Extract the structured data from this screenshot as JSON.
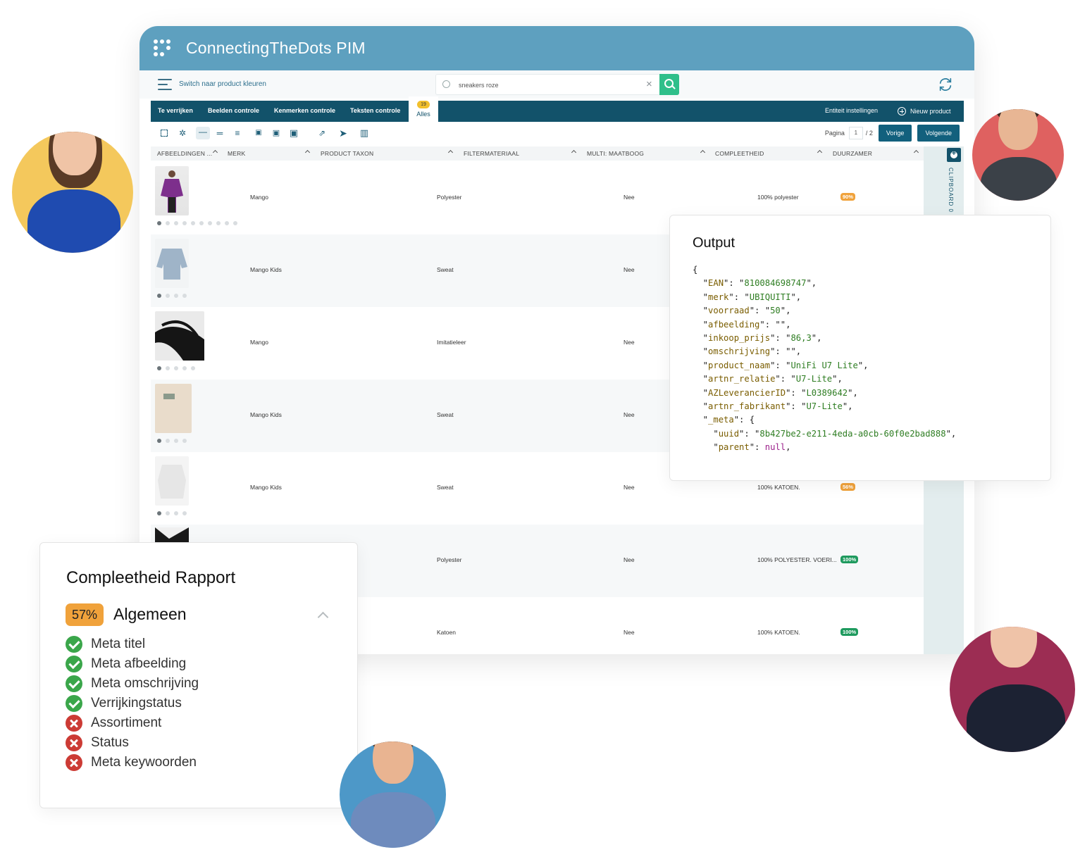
{
  "app": {
    "title": "ConnectingTheDots PIM"
  },
  "toolbar": {
    "switch_label": "Switch naar product kleuren",
    "search_value": "sneakers roze"
  },
  "tabs": [
    {
      "label": "Te verrijken"
    },
    {
      "label": "Beelden controle"
    },
    {
      "label": "Kenmerken controle"
    },
    {
      "label": "Teksten controle"
    },
    {
      "label": "Alles",
      "badge": "19",
      "active": true
    }
  ],
  "tab_actions": {
    "entity_settings": "Entiteit instellingen",
    "new_product": "Nieuw product"
  },
  "pager": {
    "label": "Pagina",
    "current": "1",
    "total": "/ 2",
    "prev": "Vorige",
    "next": "Volgende"
  },
  "columns": [
    "AFBEELDINGEN ...",
    "MERK",
    "PRODUCT TAXON",
    "FILTERMATERIAAL",
    "MULTI: MAATBOOG",
    "COMPLEETHEID",
    "DUURZAMER"
  ],
  "rows": [
    {
      "merk": "Mango",
      "taxon": "Polyester",
      "maatboog": "Nee",
      "material": "100% polyester",
      "pct": "90%",
      "pct_color": "#f0a23b",
      "image_count": 11
    },
    {
      "merk": "Mango Kids",
      "taxon": "Sweat",
      "maatboog": "Nee",
      "material": "",
      "pct": "",
      "pct_color": "",
      "image_count": 4
    },
    {
      "merk": "Mango",
      "taxon": "Imitatieleer",
      "maatboog": "Nee",
      "material": "",
      "pct": "",
      "pct_color": "",
      "image_count": 5
    },
    {
      "merk": "Mango Kids",
      "taxon": "Sweat",
      "maatboog": "Nee",
      "material": "",
      "pct": "",
      "pct_color": "",
      "image_count": 4
    },
    {
      "merk": "Mango Kids",
      "taxon": "Sweat",
      "maatboog": "Nee",
      "material": "100% KATOEN.",
      "pct": "56%",
      "pct_color": "#f0a23b",
      "image_count": 4
    },
    {
      "merk": "",
      "taxon": "Polyester",
      "maatboog": "Nee",
      "material": "100% POLYESTER. VOERI...",
      "pct": "100%",
      "pct_color": "#1e9a5e",
      "image_count": 0
    },
    {
      "merk": "",
      "taxon": "Katoen",
      "maatboog": "Nee",
      "material": "100% KATOEN.",
      "pct": "100%",
      "pct_color": "#1e9a5e",
      "image_count": 0
    }
  ],
  "clipboard": {
    "label": "CLIPBOARD",
    "count": "0"
  },
  "output": {
    "title": "Output",
    "fields": [
      {
        "key": "EAN",
        "value": "810084698747"
      },
      {
        "key": "merk",
        "value": "UBIQUITI"
      },
      {
        "key": "voorraad",
        "value": "50"
      },
      {
        "key": "afbeelding",
        "value": ""
      },
      {
        "key": "inkoop_prijs",
        "value": "86,3"
      },
      {
        "key": "omschrijving",
        "value": ""
      },
      {
        "key": "product_naam",
        "value": "UniFi U7 Lite"
      },
      {
        "key": "artnr_relatie",
        "value": "U7-Lite"
      },
      {
        "key": "AZLeverancierID",
        "value": "L0389642"
      },
      {
        "key": "artnr_fabrikant",
        "value": "U7-Lite"
      }
    ],
    "meta_key": "_meta",
    "meta": [
      {
        "key": "uuid",
        "value": "8b427be2-e211-4eda-a0cb-60f0e2bad888"
      },
      {
        "key": "parent",
        "value": "null"
      }
    ]
  },
  "rapport": {
    "title": "Compleetheid Rapport",
    "percent": "57%",
    "group": "Algemeen",
    "items": [
      {
        "label": "Meta titel",
        "ok": true
      },
      {
        "label": "Meta afbeelding",
        "ok": true
      },
      {
        "label": "Meta omschrijving",
        "ok": true
      },
      {
        "label": "Verrijkingstatus",
        "ok": true
      },
      {
        "label": "Assortiment",
        "ok": false
      },
      {
        "label": "Status",
        "ok": false
      },
      {
        "label": "Meta keywoorden",
        "ok": false
      }
    ]
  },
  "colors": {
    "header": "#5ea0bf",
    "tabbar": "#12526a",
    "accent_green": "#2fbf8a",
    "ok": "#3aa64a",
    "fail": "#cc3b35",
    "warn": "#f0a23b"
  }
}
